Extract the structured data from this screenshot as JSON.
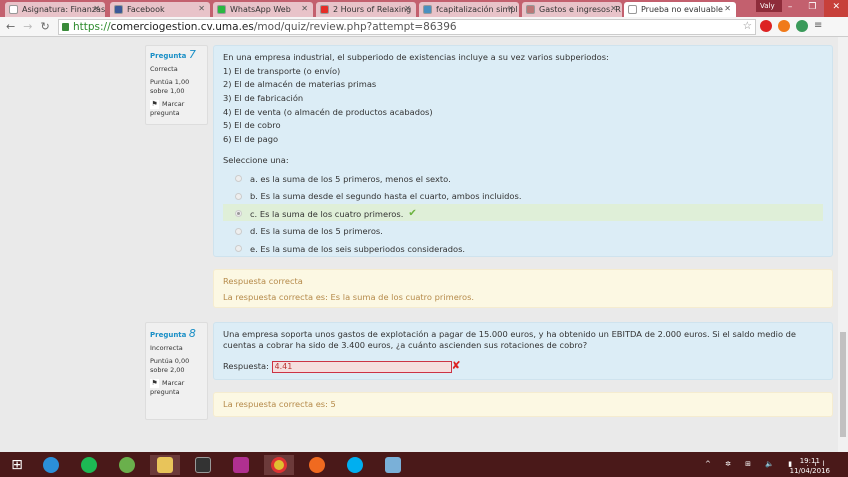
{
  "browser": {
    "tabs": [
      {
        "label": "Asignatura: Finanzas",
        "color": "#ffffff"
      },
      {
        "label": "Facebook",
        "color": "#3b5998"
      },
      {
        "label": "WhatsApp Web",
        "color": "#2bb741"
      },
      {
        "label": "2 Hours of Relaxing",
        "color": "#e52d27"
      },
      {
        "label": "fcapitalización simpl",
        "color": "#4a90c0"
      },
      {
        "label": "Gastos e ingresos. R",
        "color": "#b77"
      },
      {
        "label": "Prueba no evaluable",
        "color": "#ffffff"
      }
    ],
    "user": "Valy",
    "url_scheme": "https://",
    "url_host": "comerciogestion.cv.uma.es",
    "url_path": "/mod/quiz/review.php?attempt=86396"
  },
  "q7": {
    "label": "Pregunta",
    "number": "7",
    "status": "Correcta",
    "score": "Puntúa 1,00 sobre 1,00",
    "flag": "Marcar pregunta",
    "text": "En una empresa industrial, el subperiodo de existencias incluye a su vez varios subperiodos:",
    "items": [
      "1) El de transporte (o envío)",
      "2) El de almacén de materias primas",
      "3) El de fabricación",
      "4) El de venta (o almacén de productos acabados)",
      "5) El de cobro",
      "6) El de pago"
    ],
    "prompt": "Seleccione una:",
    "options": [
      "a. es la suma de los 5 primeros, menos el sexto.",
      "b. Es la suma desde el segundo hasta el cuarto, ambos incluidos.",
      "c. Es la suma de los cuatro primeros.",
      "d. Es la suma de los 5 primeros.",
      "e. Es la suma de los seis subperiodos considerados."
    ],
    "feedback_title": "Respuesta correcta",
    "feedback": "La respuesta correcta es: Es la suma de los cuatro primeros."
  },
  "q8": {
    "label": "Pregunta",
    "number": "8",
    "status": "Incorrecta",
    "score": "Puntúa 0,00 sobre 2,00",
    "flag": "Marcar pregunta",
    "text": "Una empresa soporta unos gastos de explotación a pagar de 15.000 euros, y ha obtenido un EBITDA de 2.000 euros. Si el saldo medio de cuentas a cobrar ha sido de 3.400 euros, ¿a cuánto ascienden sus rotaciones de cobro?",
    "answer_label": "Respuesta:",
    "answer": "4.41",
    "feedback": "La respuesta correcta es: 5"
  },
  "taskbar": {
    "time": "19:11",
    "date": "11/04/2016"
  }
}
